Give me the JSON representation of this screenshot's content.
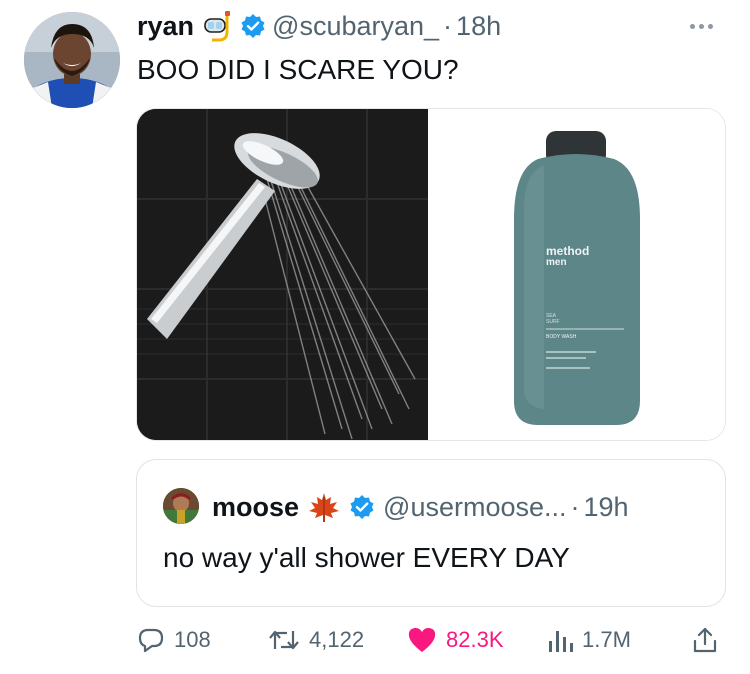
{
  "tweet": {
    "author": {
      "display_name": "ryan",
      "handle": "@scubaryan_",
      "time": "18h",
      "emoji_icon": "snorkel-mask-icon",
      "verified": true
    },
    "text": "BOO DID I SCARE YOU?",
    "media": [
      {
        "description_icon": "shower-head-icon"
      },
      {
        "product_brand": "method",
        "product_sub": "men",
        "product_line1": "SEA",
        "product_line2": "SURF",
        "product_label": "BODY WASH"
      }
    ]
  },
  "quote": {
    "author": {
      "display_name": "moose",
      "handle": "@usermoose...",
      "time": "19h",
      "emoji_icon": "maple-leaf-icon",
      "verified": true
    },
    "text": "no way y'all shower EVERY DAY"
  },
  "actions": {
    "replies": "108",
    "retweets": "4,122",
    "likes": "82.3K",
    "views": "1.7M"
  },
  "colors": {
    "verified_blue": "#1d9bf0",
    "like_pink": "#f91880",
    "muted_gray": "#536471"
  }
}
